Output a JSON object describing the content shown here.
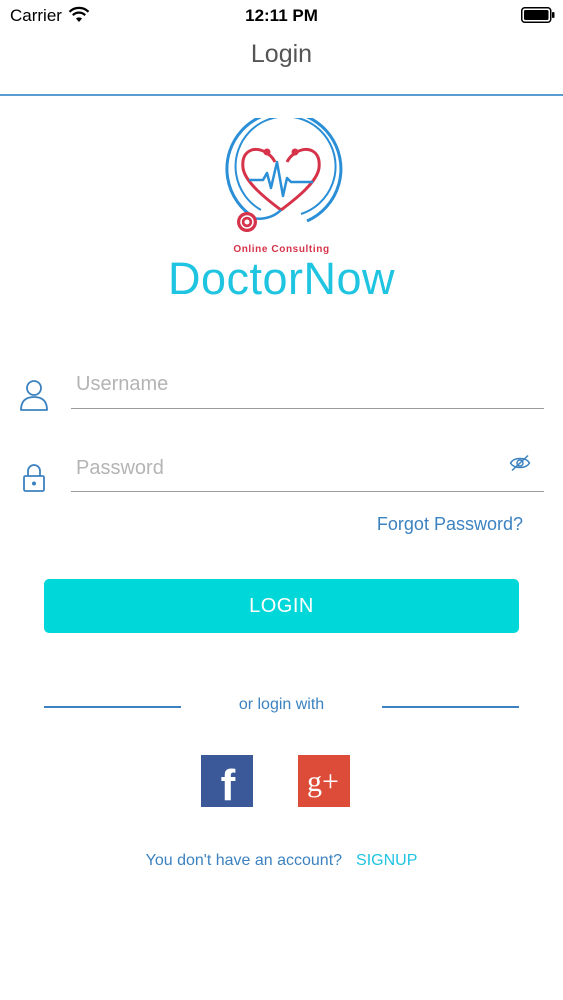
{
  "status_bar": {
    "carrier": "Carrier",
    "time": "12:11 PM",
    "icons": [
      "wifi-icon",
      "battery-icon"
    ]
  },
  "nav": {
    "title": "Login"
  },
  "logo": {
    "tagline": "Online Consulting",
    "name": "DoctorNow",
    "icon": "stethoscope-heart-logo",
    "colors": {
      "blue": "#2a8fd6",
      "red": "#d6334a",
      "cyan": "#1fc4e0"
    }
  },
  "form": {
    "username": {
      "placeholder": "Username",
      "value": "",
      "icon": "user-icon"
    },
    "password": {
      "placeholder": "Password",
      "value": "",
      "icon": "lock-icon",
      "toggle_icon": "eye-slash-icon"
    },
    "forgot_label": "Forgot Password?",
    "login_label": "LOGIN"
  },
  "social": {
    "divider_text": "or login with",
    "facebook": {
      "glyph": "f",
      "icon": "facebook-icon",
      "color": "#3b5998"
    },
    "google_plus": {
      "glyph": "g+",
      "icon": "google-plus-icon",
      "color": "#dd4b39"
    }
  },
  "signup": {
    "prompt": "You don't have an account?",
    "link_label": "SIGNUP"
  },
  "colors": {
    "accent": "#00d7d9",
    "link": "#3c82c0",
    "divider": "#5a9bd0"
  }
}
